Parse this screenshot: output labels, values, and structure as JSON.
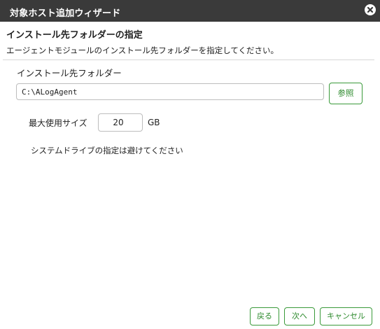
{
  "window": {
    "title": "対象ホスト追加ウィザード",
    "close_icon": "close-icon"
  },
  "page": {
    "heading": "インストール先フォルダーの指定",
    "description": "エージェントモジュールのインストール先フォルダーを指定してください。"
  },
  "folder": {
    "label": "インストール先フォルダー",
    "value": "C:\\ALogAgent",
    "browse_label": "参照"
  },
  "size": {
    "label": "最大使用サイズ",
    "value": "20",
    "unit": "GB",
    "note": "システムドライブの指定は避けてください"
  },
  "footer": {
    "back_label": "戻る",
    "next_label": "次へ",
    "cancel_label": "キャンセル"
  },
  "colors": {
    "titlebar": "#3a3a3a",
    "accent": "#2e8b2e"
  }
}
